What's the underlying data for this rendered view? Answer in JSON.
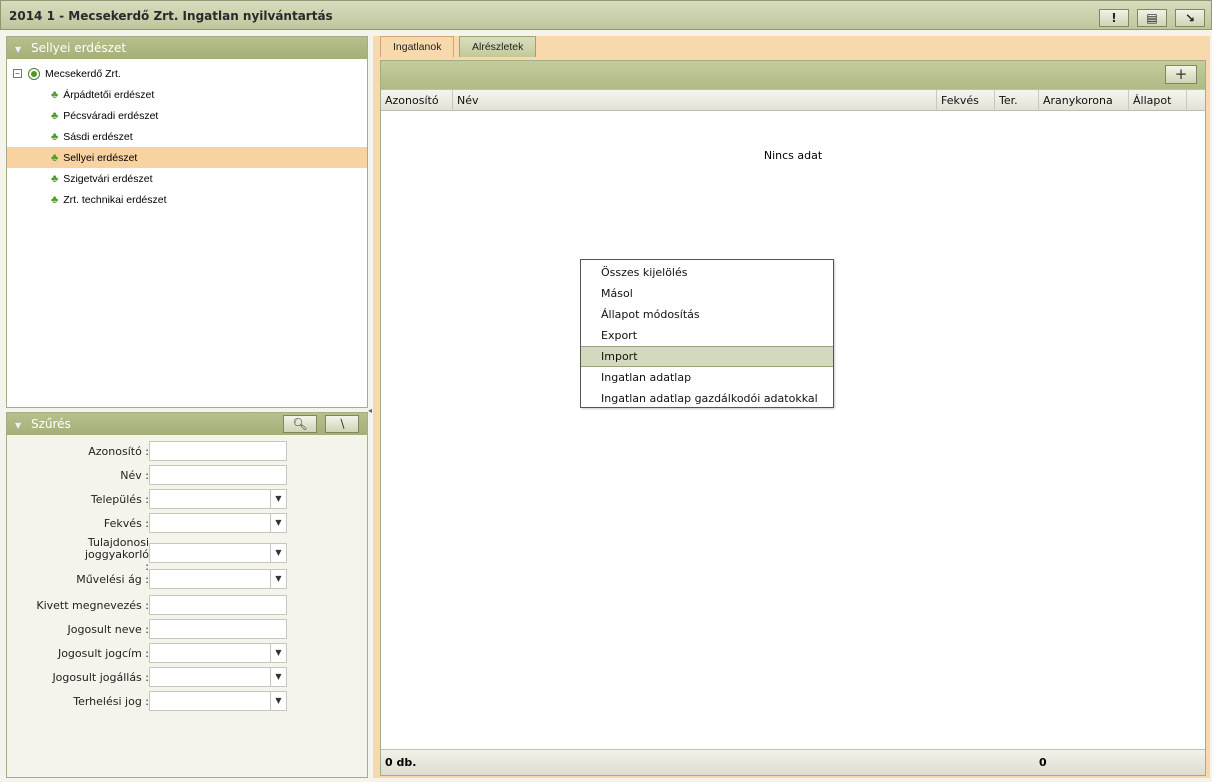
{
  "window": {
    "title": "2014 1 - Mecsekerdő Zrt. Ingatlan nyilvántartás",
    "buttons": [
      {
        "name": "info-button",
        "glyph": "!"
      },
      {
        "name": "list-button",
        "glyph": "▤"
      },
      {
        "name": "minimize-button",
        "glyph": "↘"
      }
    ]
  },
  "tree_panel": {
    "title": "Sellyei erdészet",
    "root": {
      "label": "Mecsekerdő Zrt.",
      "toggle": "⊟"
    },
    "items": [
      {
        "label": "Árpádtetői erdészet",
        "selected": false
      },
      {
        "label": "Pécsváradi erdészet",
        "selected": false
      },
      {
        "label": "Sásdi erdészet",
        "selected": false
      },
      {
        "label": "Sellyei erdészet",
        "selected": true
      },
      {
        "label": "Szigetvári erdészet",
        "selected": false
      },
      {
        "label": "Zrt. technikai erdészet",
        "selected": false
      }
    ]
  },
  "filter_panel": {
    "title": "Szűrés",
    "fields": [
      {
        "label": "Azonosító :",
        "type": "text"
      },
      {
        "label": "Név :",
        "type": "text"
      },
      {
        "label": "Település :",
        "type": "select"
      },
      {
        "label": "Fekvés :",
        "type": "select"
      },
      {
        "label": "Tulajdonosi joggyakorló :",
        "type": "select"
      },
      {
        "label": "Művelési ág :",
        "type": "select"
      },
      {
        "label": "Kivett megnevezés :",
        "type": "text"
      },
      {
        "label": "Jogosult neve :",
        "type": "text"
      },
      {
        "label": "Jogosult jogcím :",
        "type": "select"
      },
      {
        "label": "Jogosult jogállás :",
        "type": "select"
      },
      {
        "label": "Terhelési jog :",
        "type": "select"
      }
    ]
  },
  "tabs": [
    {
      "label": "Ingatlanok",
      "active": true
    },
    {
      "label": "Alrészletek",
      "active": false
    }
  ],
  "grid": {
    "add_label": "+",
    "columns": [
      "Azonosító",
      "Név",
      "Fekvés",
      "Ter.",
      "Aranykorona",
      "Állapot",
      ""
    ],
    "empty_text": "Nincs adat",
    "footer_count": "0 db.",
    "footer_sum": "0"
  },
  "context_menu": {
    "items": [
      {
        "label": "Összes kijelölés",
        "hover": false
      },
      {
        "label": "Másol",
        "hover": false
      },
      {
        "label": "Állapot módosítás",
        "hover": false
      },
      {
        "label": "Export",
        "hover": false
      },
      {
        "label": "Import",
        "hover": true
      },
      {
        "label": "Ingatlan adatlap",
        "hover": false
      },
      {
        "label": "Ingatlan adatlap gazdálkodói adatokkal",
        "hover": false
      }
    ]
  }
}
